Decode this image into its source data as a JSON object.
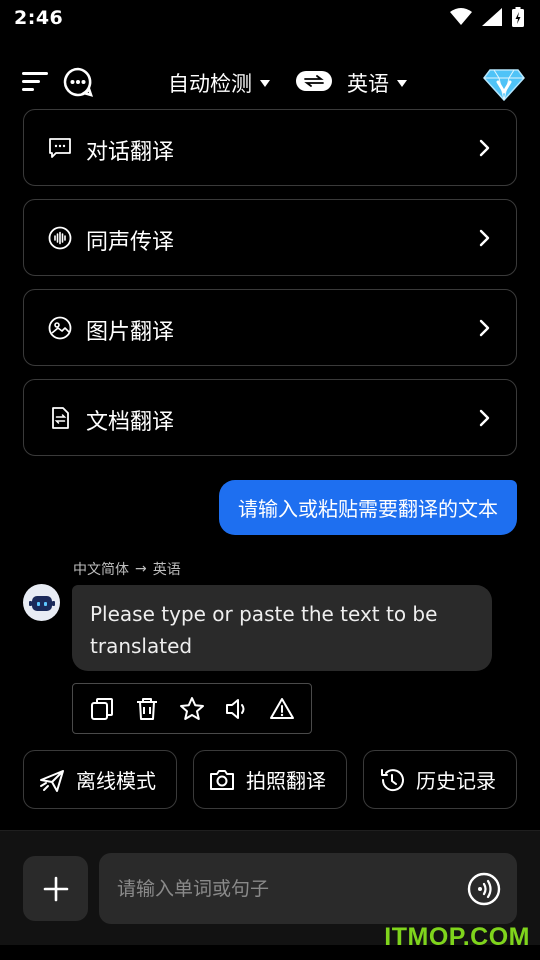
{
  "status_bar": {
    "time": "2:46"
  },
  "header": {
    "source_language": "自动检测",
    "target_language": "英语"
  },
  "features": [
    {
      "label": "对话翻译",
      "icon": "chat-bubble-icon"
    },
    {
      "label": "同声传译",
      "icon": "sound-wave-icon"
    },
    {
      "label": "图片翻译",
      "icon": "image-icon"
    },
    {
      "label": "文档翻译",
      "icon": "document-icon"
    }
  ],
  "conversation": {
    "user_message": "请输入或粘贴需要翻译的文本",
    "lang_pair_from": "中文简体",
    "lang_pair_arrow": "→",
    "lang_pair_to": "英语",
    "bot_message": "Please type or paste the text to be translated"
  },
  "actions": [
    "copy-icon",
    "delete-icon",
    "star-icon",
    "speaker-icon",
    "warning-icon"
  ],
  "quick_actions": [
    {
      "label": "离线模式",
      "icon": "airplane-icon"
    },
    {
      "label": "拍照翻译",
      "icon": "camera-icon"
    },
    {
      "label": "历史记录",
      "icon": "history-icon"
    }
  ],
  "composer": {
    "placeholder": "请输入单词或句子",
    "value": ""
  },
  "watermark": "ITMOP.COM",
  "colors": {
    "background": "#000000",
    "user_bubble": "#1e6ff0",
    "bot_bubble": "#2a2a2a",
    "watermark": "#7fd41c"
  }
}
